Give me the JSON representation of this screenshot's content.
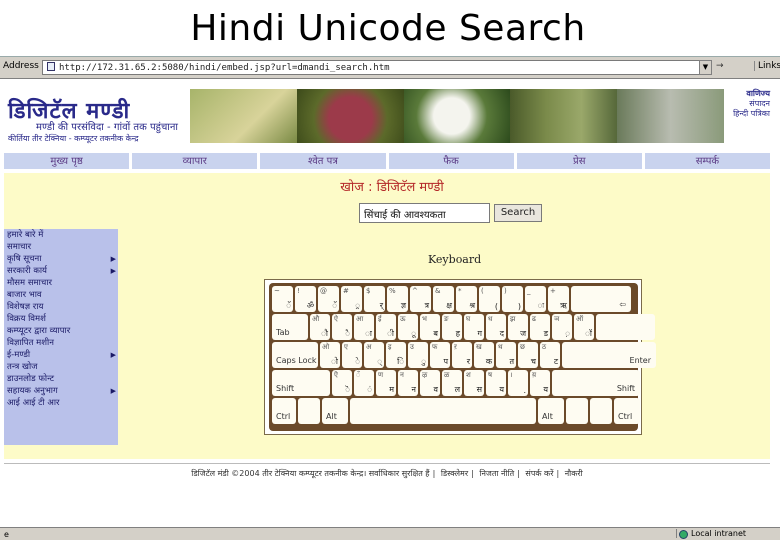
{
  "slide": {
    "title": "Hindi Unicode Search"
  },
  "browser": {
    "address_label": "Address",
    "address_url": "http://172.31.65.2:5080/hindi/embed.jsp?url=dmandi_search.htm",
    "links_label": "Links",
    "status_left": "e",
    "status_zone": "Local intranet"
  },
  "site": {
    "logo_title": "डिजिटॅल मण्डी",
    "tagline": "मण्डी की परसंविदा - गांवों तक पहुंचाना",
    "subtitle": "कीर्तिया तीर टेक्निया - कम्प्यूटर तकनीक केन्द्र",
    "header_right": [
      "वाणिज्य",
      "संपादन",
      "हिन्दी पत्रिका"
    ]
  },
  "nav": [
    "मुख्य पृष्ठ",
    "व्यापार",
    "श्वेत पत्र",
    "फैक",
    "प्रेस",
    "सम्पर्क"
  ],
  "search": {
    "heading": "खोज : डिजिटॅल मण्डी",
    "input_value": "सिंचाई की आवश्यकता",
    "button_label": "Search"
  },
  "menu": [
    {
      "label": "हमारे बारे में",
      "arrow": false
    },
    {
      "label": "समाचार",
      "arrow": false
    },
    {
      "label": "कृषि सूचना",
      "arrow": true
    },
    {
      "label": "सरकारी कार्य",
      "arrow": true
    },
    {
      "label": "मौसम समाचार",
      "arrow": false
    },
    {
      "label": "बाजार भाव",
      "arrow": false
    },
    {
      "label": "विशेषज्ञ राय",
      "arrow": false
    },
    {
      "label": "विक्रय विमर्श",
      "arrow": false
    },
    {
      "label": "कम्प्यूटर द्वारा व्यापार",
      "arrow": false
    },
    {
      "label": "विज्ञापित मशीन",
      "arrow": false
    },
    {
      "label": "ई-मण्डी",
      "arrow": true
    },
    {
      "label": "तन्त्र खोज",
      "arrow": false
    },
    {
      "label": "डाउनलोड फोन्ट",
      "arrow": false
    },
    {
      "label": "सहायक अनुभाग",
      "arrow": true
    },
    {
      "label": "आई आई टी आर",
      "arrow": false
    }
  ],
  "keyboard": {
    "label": "Keyboard",
    "row1": [
      [
        "~",
        "ॅ"
      ],
      [
        "!",
        "ॐ"
      ],
      [
        "@",
        "ॅ"
      ],
      [
        "#",
        "्र"
      ],
      [
        "$",
        "र्"
      ],
      [
        "%",
        "ज्ञ"
      ],
      [
        "^",
        "त्र"
      ],
      [
        "&",
        "क्ष"
      ],
      [
        "*",
        "श्र"
      ],
      [
        "(",
        "("
      ],
      [
        ")",
        ")"
      ],
      [
        "_",
        "ः"
      ],
      [
        "+",
        "ऋ"
      ]
    ],
    "row1_end": "⇦",
    "tab_label": "Tab",
    "row2": [
      [
        "औ",
        "ौ"
      ],
      [
        "ऐ",
        "ै"
      ],
      [
        "आ",
        "ा"
      ],
      [
        "ई",
        "ी"
      ],
      [
        "ऊ",
        "ू"
      ],
      [
        "भ",
        "ब"
      ],
      [
        "ङ",
        "ह"
      ],
      [
        "घ",
        "ग"
      ],
      [
        "ध",
        "द"
      ],
      [
        "झ",
        "ज"
      ],
      [
        "ढ",
        "ड"
      ],
      [
        "ञ",
        "़"
      ],
      [
        "ऑ",
        "ॉ"
      ]
    ],
    "caps_label": "Caps Lock",
    "row3": [
      [
        "ओ",
        "ो"
      ],
      [
        "ए",
        "े"
      ],
      [
        "अ",
        "्"
      ],
      [
        "इ",
        "ि"
      ],
      [
        "उ",
        "ु"
      ],
      [
        "फ",
        "प"
      ],
      [
        "ऱ",
        "र"
      ],
      [
        "ख",
        "क"
      ],
      [
        "थ",
        "त"
      ],
      [
        "छ",
        "च"
      ],
      [
        "ठ",
        "ट"
      ]
    ],
    "enter_label": "Enter",
    "shift_left": "Shift",
    "row4": [
      [
        "ऎ",
        "ॆ"
      ],
      [
        "ँ",
        "ं"
      ],
      [
        "ण",
        "म"
      ],
      [
        "न",
        "न"
      ],
      [
        "ऴ",
        "व"
      ],
      [
        "ळ",
        "ल"
      ],
      [
        "श",
        "स"
      ],
      [
        "ष",
        "य"
      ],
      [
        "।",
        "."
      ],
      [
        "य़",
        "य"
      ]
    ],
    "shift_right": "Shift",
    "ctrl_label": "Ctrl",
    "alt_label": "Alt"
  },
  "footer": [
    "डिजिटॅल मंडी ©2004 तीर टेक्निया कम्प्यूटर तकनीक केन्द्र। सर्वाधिकार सुरक्षित हैं",
    "डिस्क्लेमर",
    "निजता नीति",
    "संपर्क करें",
    "नौकरी"
  ]
}
